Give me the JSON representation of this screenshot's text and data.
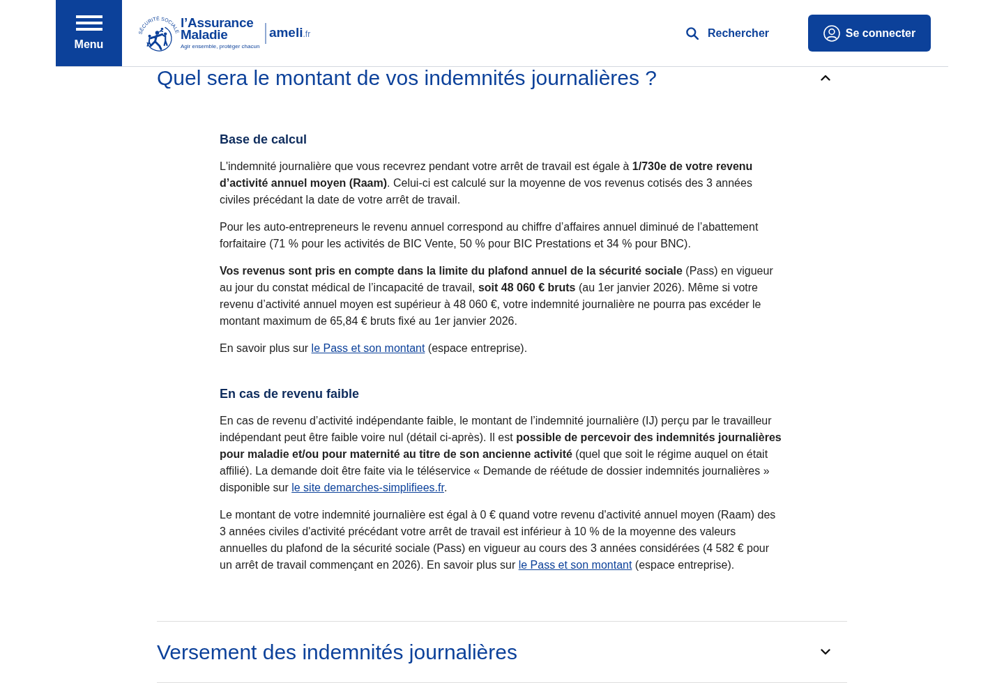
{
  "header": {
    "menu_label": "Menu",
    "logo": {
      "seal_text": "SÉCURITÉ SOCIALE",
      "brand_line_1": "l’Assurance",
      "brand_line_2": "Maladie",
      "tagline": "Agir ensemble, protéger chacun",
      "site_name": "ameli",
      "site_suffix": ".fr"
    },
    "search_label": "Rechercher",
    "login_label": "Se connecter"
  },
  "accordions": [
    {
      "title": "Quel sera le montant de vos indemnités journalières ?",
      "expanded": true,
      "sections": [
        {
          "heading": "Base de calcul",
          "paragraphs": [
            [
              {
                "kind": "text",
                "text": "L'indemnité journalière que vous recevrez pendant votre arrêt de travail est égale à **1/730e de votre revenu d’activité annuel moyen (Raam)**. Celui-ci est calculé sur la moyenne de vos revenus cotisés des 3 années civiles précédant la date de votre arrêt de travail."
              }
            ],
            [
              {
                "kind": "text",
                "text": "Pour les auto-entrepreneurs le revenu annuel correspond au chiffre d’affaires annuel diminué de l’abattement forfaitaire (71 % pour les activités de BIC Vente, 50 % pour BIC Prestations et 34 % pour BNC)."
              }
            ],
            [
              {
                "kind": "text",
                "text": "**Vos revenus sont pris en compte dans la limite du plafond annuel de la sécurité sociale** (Pass) en vigueur au jour du constat médical de l’incapacité de travail, **soit 48 060 € bruts** (au 1er janvier 2026). Même si votre revenu d’activité annuel moyen est supérieur à 48 060 €, votre indemnité journalière ne pourra pas excéder le montant maximum de 65,84 € bruts fixé au 1er janvier 2026."
              }
            ],
            [
              {
                "kind": "text",
                "text": "En savoir plus sur "
              },
              {
                "kind": "link",
                "text": "le Pass et son montant"
              },
              {
                "kind": "text",
                "text": " (espace entreprise)."
              }
            ]
          ]
        },
        {
          "heading": "En cas de revenu faible",
          "paragraphs": [
            [
              {
                "kind": "text",
                "text": "En cas de revenu d’activité indépendante faible, le montant de l’indemnité journalière (IJ) perçu par le travailleur indépendant peut être faible voire nul (détail ci-après). Il est **possible de percevoir des indemnités journalières pour maladie et/ou pour maternité au titre de son ancienne activité** (quel que soit le régime auquel on était affilié). La demande doit être faite via le téléservice « Demande de réétude de dossier indemnités journalières » disponible sur "
              },
              {
                "kind": "link",
                "text": "le site demarches-simplifiees.fr"
              },
              {
                "kind": "text",
                "text": "."
              }
            ],
            [
              {
                "kind": "text",
                "text": "Le montant de votre indemnité journalière est égal à 0 € quand votre revenu d'activité annuel moyen (Raam) des 3 années civiles d'activité précédant votre arrêt de travail est inférieur à 10 % de la moyenne des valeurs annuelles du plafond de la sécurité sociale (Pass) en vigueur au cours des 3 années considérées (4 582 € pour un arrêt de travail commençant en 2026). En savoir plus sur "
              },
              {
                "kind": "link",
                "text": "le Pass et son montant"
              },
              {
                "kind": "text",
                "text": " (espace entreprise)."
              }
            ]
          ]
        }
      ]
    },
    {
      "title": "Versement des indemnités journalières",
      "expanded": false
    }
  ]
}
